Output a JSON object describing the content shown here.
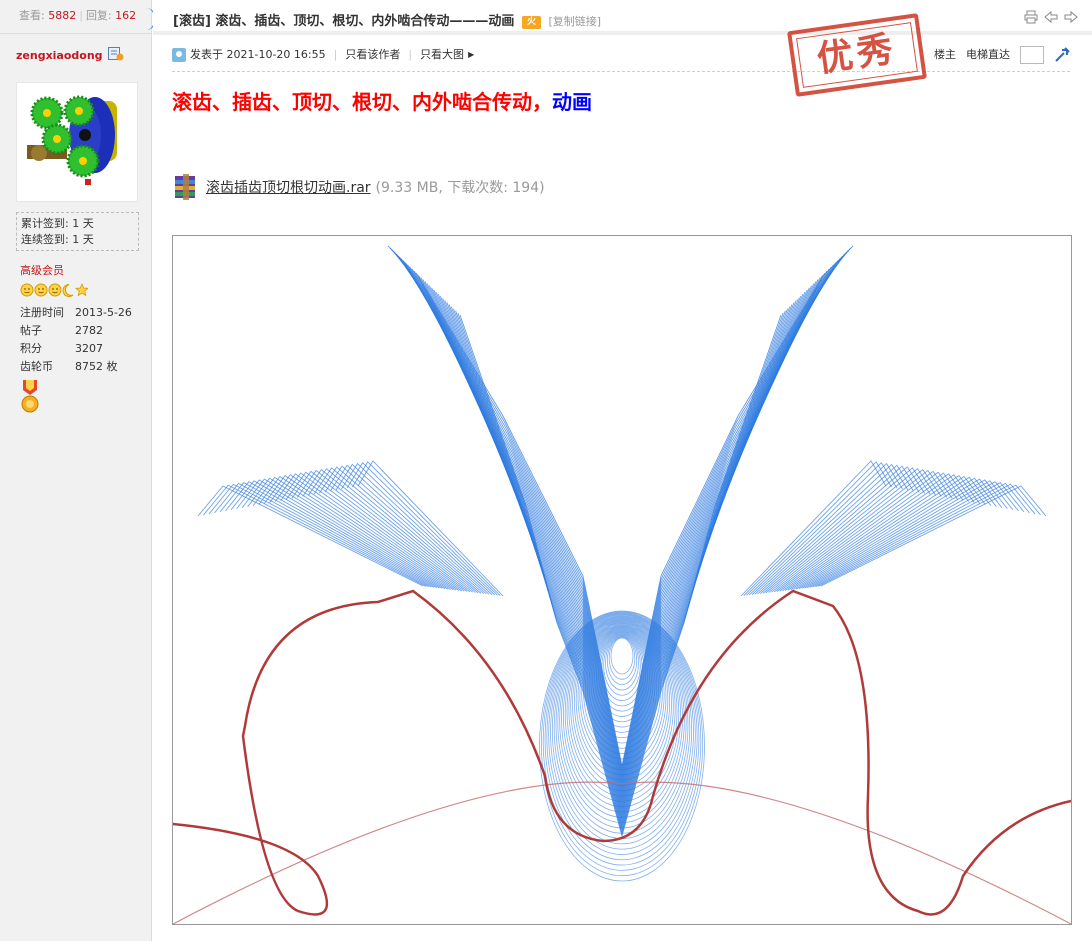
{
  "stats": {
    "views_label": "查看:",
    "views": "5882",
    "replies_label": "回复:",
    "replies": "162"
  },
  "user": {
    "name": "zengxiaodong",
    "checkin_total_label": "累计签到:",
    "checkin_total": "1 天",
    "checkin_streak_label": "连续签到:",
    "checkin_streak": "1 天",
    "group": "高级会员",
    "profile": [
      {
        "k": "注册时间",
        "v": "2013-5-26"
      },
      {
        "k": "帖子",
        "v": "2782"
      },
      {
        "k": "积分",
        "v": "3207"
      },
      {
        "k": "齿轮币",
        "v": "8752 枚"
      }
    ]
  },
  "thread": {
    "category": "[滚齿]",
    "title": "滚齿、插齿、顶切、根切、内外啮合传动———动画",
    "copy_link": "[复制链接]",
    "hot_badge": "火"
  },
  "post": {
    "posted_prefix": "发表于",
    "posted_time": "2021-10-20 16:55",
    "only_author": "只看该作者",
    "only_big_image": "只看大图",
    "floor": "楼主",
    "elevator": "电梯直达",
    "stamp": "优秀",
    "heading_main": "滚齿、插齿、顶切、根切、内外啮合传动，",
    "heading_tail": "动画",
    "attachment": {
      "name": "滚齿插齿顶切根切动画.rar",
      "info": "(9.33 MB, 下载次数: 194)"
    }
  },
  "colors": {
    "accent_red": "#c4161c",
    "heading_red": "#ff0000",
    "heading_blue": "#0000ff",
    "tooth_outline": "#b03a3a",
    "cutter_lines": "#2f7be0"
  }
}
